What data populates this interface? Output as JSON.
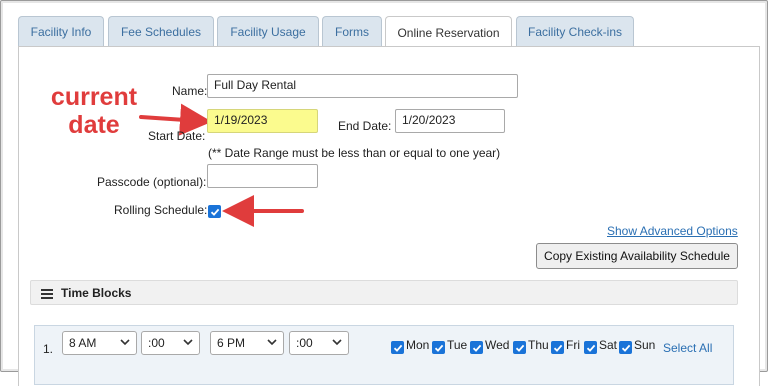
{
  "tabs": [
    {
      "label": "Facility Info",
      "active": false
    },
    {
      "label": "Fee Schedules",
      "active": false
    },
    {
      "label": "Facility Usage",
      "active": false
    },
    {
      "label": "Forms",
      "active": false
    },
    {
      "label": "Online Reservation",
      "active": true
    },
    {
      "label": "Facility Check-ins",
      "active": false
    }
  ],
  "form": {
    "name_label": "Name:",
    "name_value": "Full Day Rental",
    "start_date_label": "Start Date:",
    "start_date_value": "1/19/2023",
    "end_date_label": "End Date:",
    "end_date_value": "1/20/2023",
    "date_note": "(** Date Range must be less than or equal to one year)",
    "passcode_label": "Passcode (optional):",
    "passcode_value": "",
    "rolling_label": "Rolling Schedule:",
    "rolling_checked": true
  },
  "annotation": {
    "line1": "current",
    "line2": "date",
    "color": "#e03c3c"
  },
  "actions": {
    "advanced_link": "Show Advanced Options",
    "copy_button": "Copy Existing Availability Schedule"
  },
  "time_blocks": {
    "title": "Time Blocks",
    "rows": [
      {
        "number": "1.",
        "start_hour": "8 AM",
        "start_min": ":00",
        "end_hour": "6 PM",
        "end_min": ":00",
        "days": [
          {
            "label": "Mon",
            "checked": true
          },
          {
            "label": "Tue",
            "checked": true
          },
          {
            "label": "Wed",
            "checked": true
          },
          {
            "label": "Thu",
            "checked": true
          },
          {
            "label": "Fri",
            "checked": true
          },
          {
            "label": "Sat",
            "checked": true
          },
          {
            "label": "Sun",
            "checked": true
          }
        ],
        "select_all": "Select All"
      }
    ]
  },
  "colors": {
    "highlight": "#fbfb8e",
    "tab_inactive": "#dbe5ee",
    "checkbox": "#1a73d8",
    "link": "#2a6fb3"
  }
}
